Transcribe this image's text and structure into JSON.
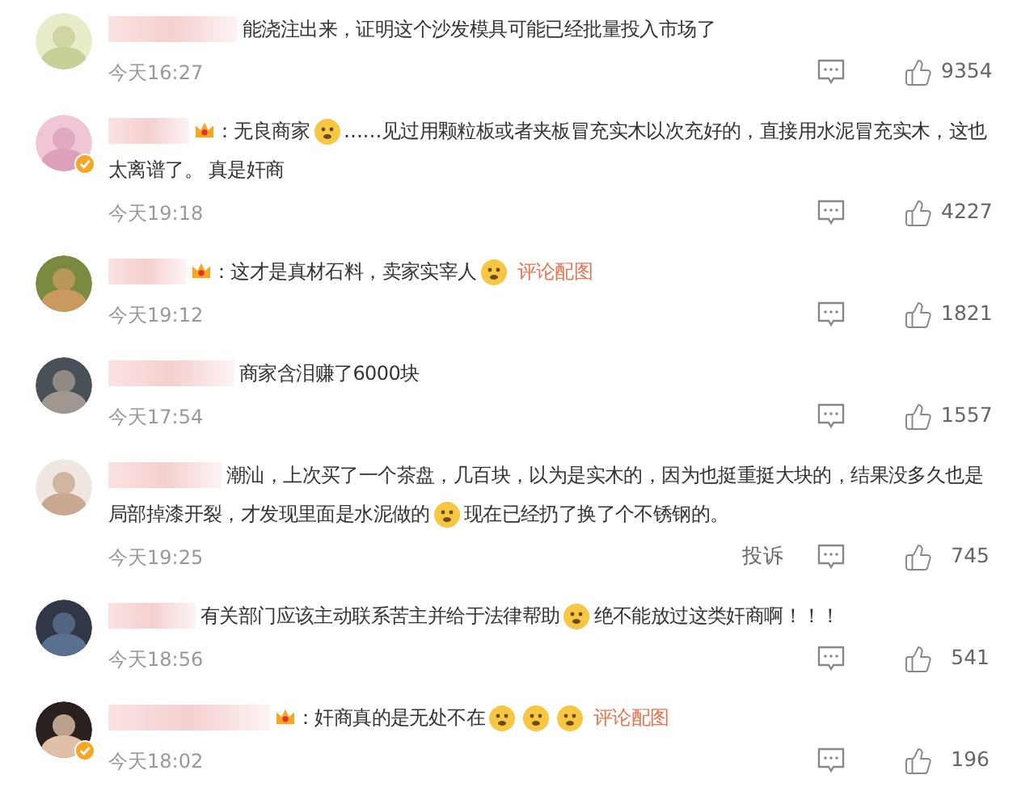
{
  "comments": [
    {
      "verified": false,
      "badge": false,
      "segments": [
        {
          "kind": "text",
          "text": "能浇注出来，证明这个沙发模具可能已经批量投入市场了"
        }
      ],
      "time": "今天16:27",
      "likes": "9354"
    },
    {
      "verified": true,
      "badge": true,
      "segments": [
        {
          "kind": "text",
          "text": "：无良商家"
        },
        {
          "kind": "emoji"
        },
        {
          "kind": "text",
          "text": "……见过用颗粒板或者夹板冒充实木以次充好的，直接用水泥冒充实木，这也"
        },
        {
          "kind": "text",
          "text": "太离谱了。 真是奸商"
        }
      ],
      "time": "今天19:18",
      "likes": "4227"
    },
    {
      "verified": false,
      "badge": true,
      "segments": [
        {
          "kind": "text",
          "text": "：这才是真材石料，卖家实宰人"
        },
        {
          "kind": "emoji"
        }
      ],
      "image_link": "评论配图",
      "time": "今天19:12",
      "likes": "1821"
    },
    {
      "verified": false,
      "badge": false,
      "segments": [
        {
          "kind": "text",
          "text": "商家含泪赚了6000块"
        }
      ],
      "time": "今天17:54",
      "likes": "1557"
    },
    {
      "verified": false,
      "badge": false,
      "segments": [
        {
          "kind": "text",
          "text": "潮汕，上次买了一个茶盘，几百块，以为是实木的，因为也挺重挺大块的，结果没多久也是"
        },
        {
          "kind": "text",
          "text": "局部掉漆开裂，才发现里面是水泥做的"
        },
        {
          "kind": "emoji"
        },
        {
          "kind": "text",
          "text": "现在已经扔了换了个不锈钢的。"
        }
      ],
      "time": "今天19:25",
      "report": "投诉",
      "likes": "745"
    },
    {
      "verified": false,
      "badge": false,
      "segments": [
        {
          "kind": "text",
          "text": "有关部门应该主动联系苦主并给于法律帮助"
        },
        {
          "kind": "emoji"
        },
        {
          "kind": "text",
          "text": "绝不能放过这类奸商啊！！！"
        }
      ],
      "time": "今天18:56",
      "likes": "541"
    },
    {
      "verified": true,
      "badge": true,
      "segments": [
        {
          "kind": "text",
          "text": "：奸商真的是无处不在"
        },
        {
          "kind": "emoji"
        },
        {
          "kind": "emoji"
        },
        {
          "kind": "emoji"
        }
      ],
      "image_link": "评论配图",
      "time": "今天18:02",
      "likes": "196"
    }
  ]
}
